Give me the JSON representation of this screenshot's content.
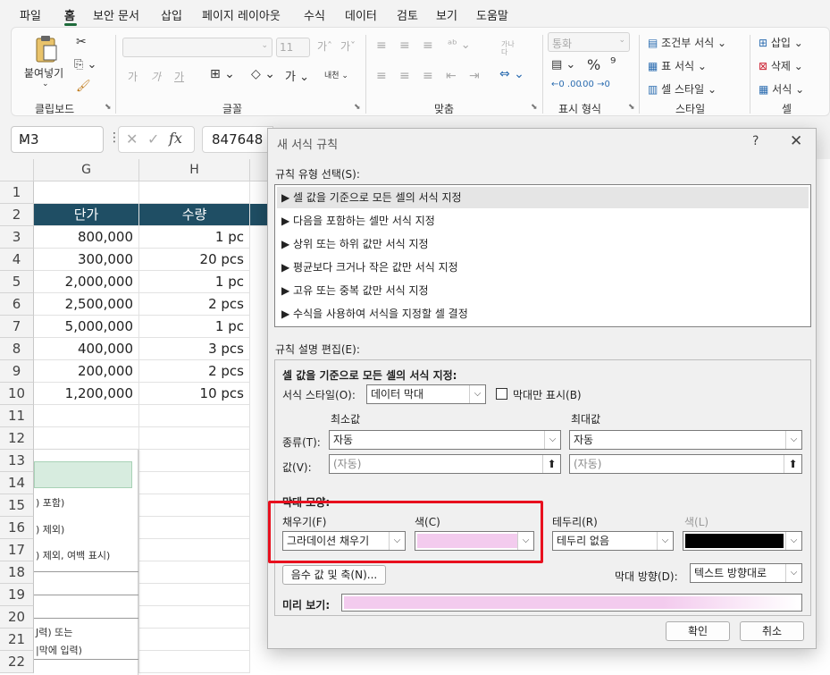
{
  "menu": {
    "tabs": [
      "파일",
      "홈",
      "보안 문서",
      "삽입",
      "페이지 레이아웃",
      "수식",
      "데이터",
      "검토",
      "보기",
      "도움말"
    ]
  },
  "ribbon": {
    "paste_label": "붙여넣기",
    "clipboard_label": "클립보드",
    "font_label": "글꼴",
    "font_size": "11",
    "align_label": "맞춤",
    "number_format_value": "통화",
    "number_label": "표시 형식",
    "styles": {
      "conditional": "조건부 서식",
      "table": "표 서식",
      "cell_style": "셀 스타일",
      "label": "스타일"
    },
    "cells": {
      "insert": "삽입",
      "delete": "삭제",
      "format": "서식",
      "label": "셀"
    },
    "wrap_icon_text": "가나\n다",
    "font_buttons": [
      "가",
      "가",
      "가"
    ]
  },
  "formula_bar": {
    "name_box": "M3",
    "value": "847648"
  },
  "sheet": {
    "columns": [
      "G",
      "H"
    ],
    "rows": [
      "1",
      "2",
      "3",
      "4",
      "5",
      "6",
      "7",
      "8",
      "9",
      "10",
      "11",
      "12",
      "13",
      "14",
      "15",
      "16",
      "17",
      "18",
      "19",
      "20",
      "21",
      "22"
    ],
    "header": [
      "단가",
      "수량"
    ],
    "data": [
      [
        "800,000",
        "1 pc"
      ],
      [
        "300,000",
        "20 pcs"
      ],
      [
        "2,000,000",
        "1 pc"
      ],
      [
        "2,500,000",
        "2 pcs"
      ],
      [
        "5,000,000",
        "1 pc"
      ],
      [
        "400,000",
        "3 pcs"
      ],
      [
        "200,000",
        "2 pcs"
      ],
      [
        "1,200,000",
        "10 pcs"
      ]
    ]
  },
  "side_panel": {
    "items": [
      ") 포함)",
      ") 제외)",
      ") 제외, 여백 표시)",
      "J력) 또는",
      "|막에 입력)"
    ]
  },
  "dialog": {
    "title": "새 서식 규칙",
    "help": "?",
    "close": "✕",
    "rule_type_label": "규칙 유형 선택(S):",
    "rule_types": [
      "▶ 셀 값을 기준으로 모든 셀의 서식 지정",
      "▶ 다음을 포함하는 셀만 서식 지정",
      "▶ 상위 또는 하위 값만 서식 지정",
      "▶ 평균보다 크거나 작은 값만 서식 지정",
      "▶ 고유 또는 중복 값만 서식 지정",
      "▶ 수식을 사용하여 서식을 지정할 셀 결정"
    ],
    "edit_label": "규칙 설명 편집(E):",
    "edit_heading": "셀 값을 기준으로 모든 셀의 서식 지정:",
    "format_style_label": "서식 스타일(O):",
    "format_style_value": "데이터 막대",
    "bar_only_label": "막대만 표시(B)",
    "min_label": "최소값",
    "max_label": "최대값",
    "type_label": "종류(T):",
    "min_type": "자동",
    "max_type": "자동",
    "value_label": "값(V):",
    "min_value": "(자동)",
    "max_value": "(자동)",
    "bar_appearance_label": "막대 모양:",
    "fill_label": "채우기(F)",
    "fill_value": "그라데이션 채우기",
    "color_label": "색(C)",
    "fill_color": "#f3cbee",
    "border_label": "테두리(R)",
    "border_value": "테두리 없음",
    "border_color_label": "색(L)",
    "border_color": "#000000",
    "negative_button": "음수 값 및 축(N)...",
    "direction_label": "막대 방향(D):",
    "direction_value": "텍스트 방향대로",
    "preview_label": "미리 보기:",
    "ok": "확인",
    "cancel": "취소"
  }
}
